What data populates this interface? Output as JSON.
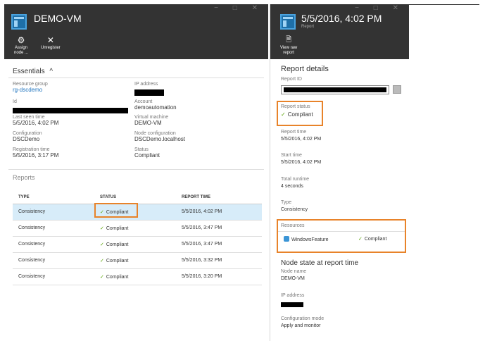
{
  "left_blade": {
    "title": "DEMO-VM",
    "window_controls": "− □ ✕",
    "commands": [
      {
        "icon": "gear-icon",
        "glyph": "⚙",
        "label1": "Assign",
        "label2": "node ..."
      },
      {
        "icon": "close-icon",
        "glyph": "✕",
        "label1": "Unregister",
        "label2": ""
      }
    ],
    "essentials": {
      "title": "Essentials",
      "toggle": "^",
      "resource_group_label": "Resource group",
      "resource_group_value": "rg-dscdemo",
      "id_label": "Id",
      "last_seen_label": "Last seen time",
      "last_seen_value": "5/5/2016, 4:02 PM",
      "configuration_label": "Configuration",
      "configuration_value": "DSCDemo",
      "registration_label": "Registration time",
      "registration_value": "5/5/2016, 3:17 PM",
      "ip_label": "IP address",
      "account_label": "Account",
      "account_value": "demoautomation",
      "vm_label": "Virtual machine",
      "vm_value": "DEMO-VM",
      "node_config_label": "Node configuration",
      "node_config_value": "DSCDemo.localhost",
      "status_label": "Status",
      "status_value": "Compliant"
    },
    "reports": {
      "title": "Reports",
      "columns": [
        "TYPE",
        "STATUS",
        "REPORT TIME"
      ],
      "rows": [
        {
          "type": "Consistency",
          "status": "Compliant",
          "time": "5/5/2016, 4:02 PM"
        },
        {
          "type": "Consistency",
          "status": "Compliant",
          "time": "5/5/2016, 3:47 PM"
        },
        {
          "type": "Consistency",
          "status": "Compliant",
          "time": "5/5/2016, 3:47 PM"
        },
        {
          "type": "Consistency",
          "status": "Compliant",
          "time": "5/5/2016, 3:32 PM"
        },
        {
          "type": "Consistency",
          "status": "Compliant",
          "time": "5/5/2016, 3:20 PM"
        }
      ]
    }
  },
  "right_blade": {
    "title": "5/5/2016, 4:02 PM",
    "subtitle": "Report",
    "window_controls": "− □ ✕",
    "command": {
      "icon": "document-icon",
      "glyph": "🗎",
      "label1": "View raw",
      "label2": "report"
    },
    "details_title": "Report details",
    "report_id_label": "Report ID",
    "report_status_label": "Report status",
    "report_status_value": "Compliant",
    "report_time_label": "Report time",
    "report_time_value": "5/5/2016, 4:02 PM",
    "start_time_label": "Start time",
    "start_time_value": "5/5/2016, 4:02 PM",
    "runtime_label": "Total runtime",
    "runtime_value": "4 seconds",
    "type_label": "Type",
    "type_value": "Consistency",
    "resources_label": "Resources",
    "resource_name": "WindowsFeature",
    "resource_status": "Compliant",
    "node_state_title": "Node state at report time",
    "node_name_label": "Node name",
    "node_name_value": "DEMO-VM",
    "ip_label": "IP address",
    "config_mode_label": "Configuration mode",
    "config_mode_value": "Apply and monitor"
  },
  "colors": {
    "header": "#333333",
    "accent": "#1e73be",
    "highlight": "#e8832a",
    "check": "#57a300",
    "selected_row": "#d7ecf9"
  }
}
